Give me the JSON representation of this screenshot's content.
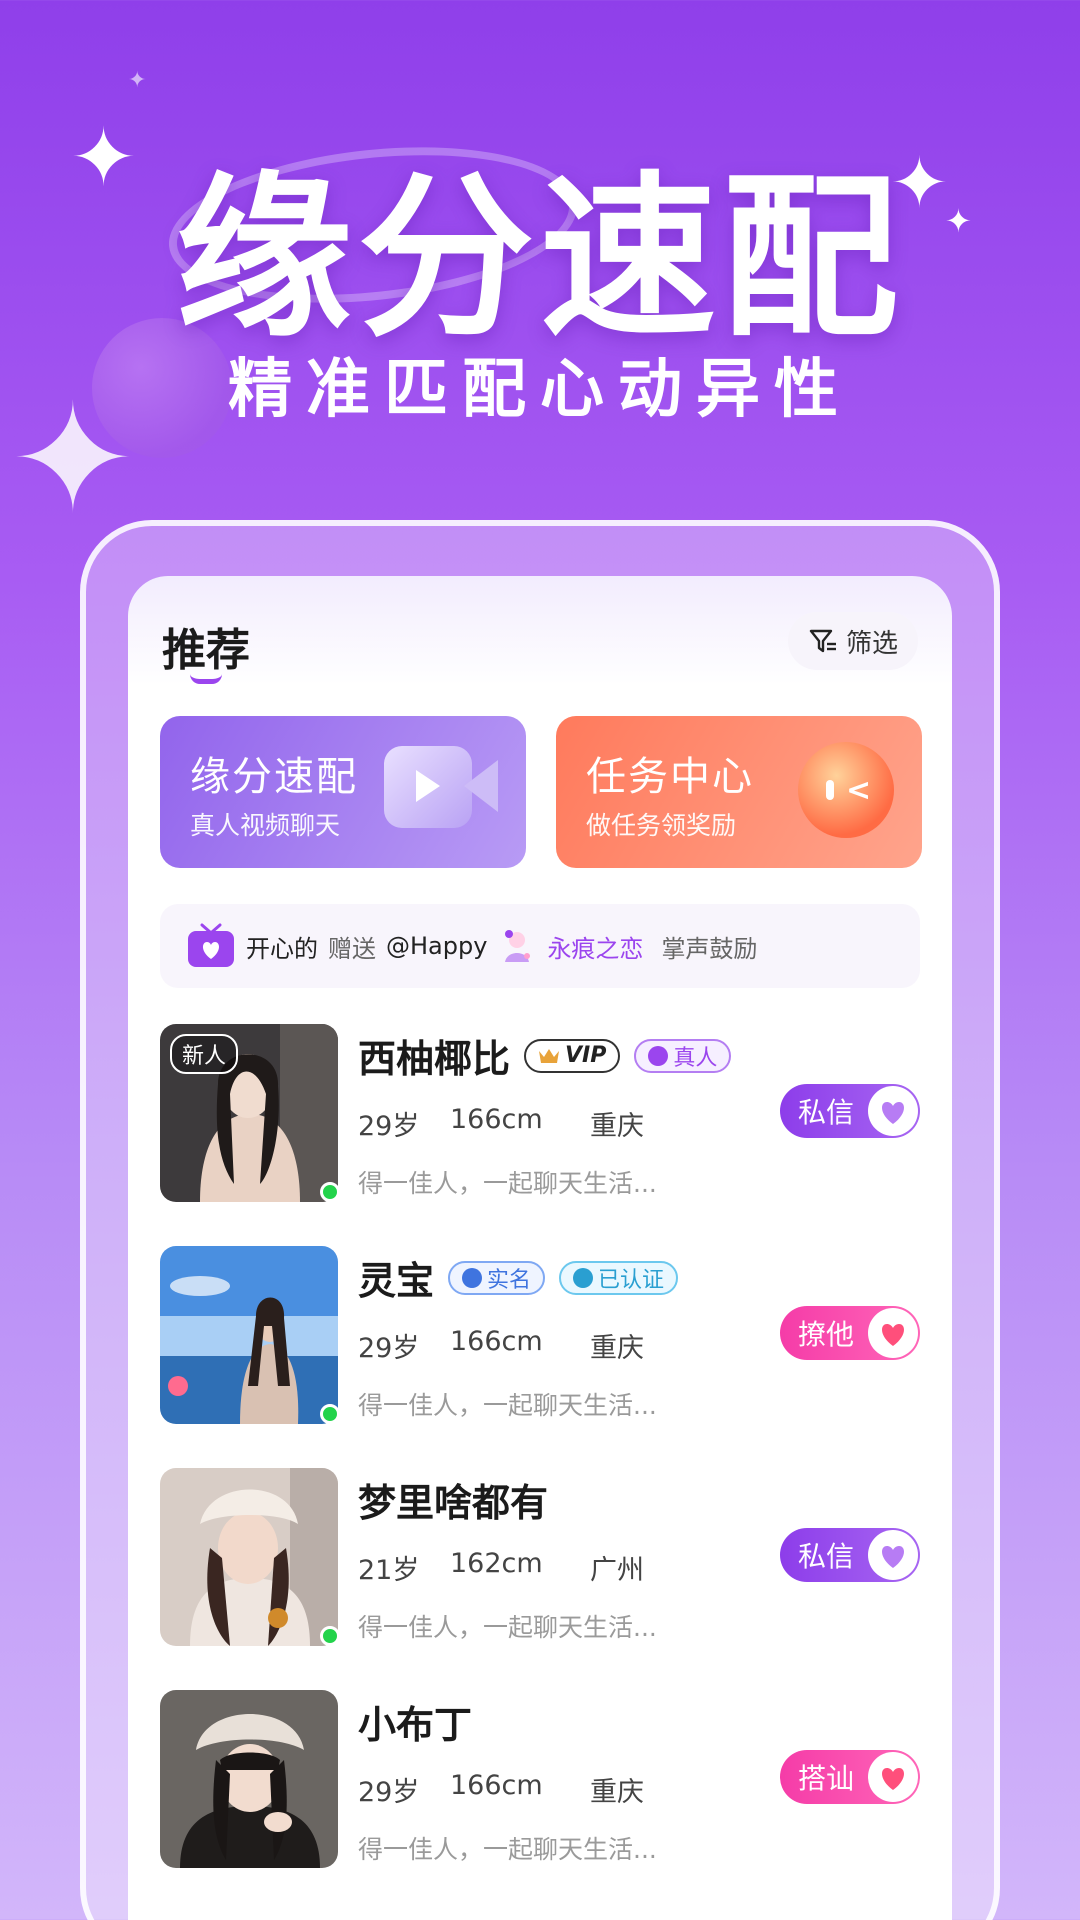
{
  "hero": {
    "title": "缘分速配",
    "subtitle": "精准匹配心动异性"
  },
  "header": {
    "tab_label": "推荐",
    "filter_label": "筛选"
  },
  "cards": {
    "match": {
      "title": "缘分速配",
      "subtitle": "真人视频聊天",
      "icon": "video-camera-icon"
    },
    "task": {
      "title": "任务中心",
      "subtitle": "做任务领奖励",
      "icon": "chat-bubble-icon"
    }
  },
  "marquee": {
    "user": "开心的",
    "action": "赠送",
    "target": "@Happy",
    "gift": "永痕之恋",
    "suffix": "掌声鼓励"
  },
  "users": [
    {
      "name": "西柚椰比",
      "is_new": true,
      "new_label": "新人",
      "online": true,
      "badges": [
        {
          "text": "VIP",
          "style": "vip"
        },
        {
          "text": "真人",
          "style": "real"
        }
      ],
      "age": "29岁",
      "height": "166cm",
      "city": "重庆",
      "intro": "得一佳人，一起聊天生活...",
      "action": "私信",
      "action_style": "purple"
    },
    {
      "name": "灵宝",
      "is_new": false,
      "online": true,
      "badges": [
        {
          "text": "实名",
          "style": "blue"
        },
        {
          "text": "已认证",
          "style": "cyan"
        }
      ],
      "age": "29岁",
      "height": "166cm",
      "city": "重庆",
      "intro": "得一佳人，一起聊天生活...",
      "action": "撩他",
      "action_style": "pink"
    },
    {
      "name": "梦里啥都有",
      "is_new": false,
      "online": true,
      "badges": [],
      "age": "21岁",
      "height": "162cm",
      "city": "广州",
      "intro": "得一佳人，一起聊天生活...",
      "action": "私信",
      "action_style": "purple"
    },
    {
      "name": "小布丁",
      "is_new": false,
      "online": false,
      "badges": [],
      "age": "29岁",
      "height": "166cm",
      "city": "重庆",
      "intro": "得一佳人，一起聊天生活...",
      "action": "搭讪",
      "action_style": "pink"
    }
  ],
  "colors": {
    "accent_purple": "#9b45ee",
    "accent_pink": "#f53ca8",
    "online_green": "#23d34b",
    "task_orange": "#ff7a5c"
  }
}
